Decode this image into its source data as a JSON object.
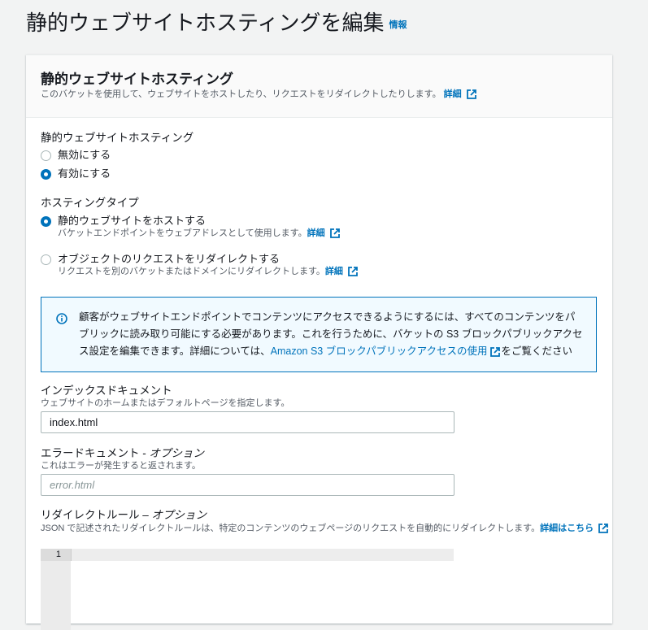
{
  "page": {
    "title": "静的ウェブサイトホスティングを編集",
    "info_link": "情報"
  },
  "card": {
    "title": "静的ウェブサイトホスティング",
    "description": "このバケットを使用して、ウェブサイトをホストしたり、リクエストをリダイレクトしたりします。",
    "details_link": "詳細"
  },
  "hosting": {
    "label": "静的ウェブサイトホスティング",
    "options": [
      {
        "label": "無効にする",
        "selected": false
      },
      {
        "label": "有効にする",
        "selected": true
      }
    ]
  },
  "hosting_type": {
    "label": "ホスティングタイプ",
    "options": [
      {
        "label": "静的ウェブサイトをホストする",
        "description": "バケットエンドポイントをウェブアドレスとして使用します。",
        "link": "詳細",
        "selected": true
      },
      {
        "label": "オブジェクトのリクエストをリダイレクトする",
        "description": "リクエストを別のバケットまたはドメインにリダイレクトします。",
        "link": "詳細",
        "selected": false
      }
    ]
  },
  "alert": {
    "text": "顧客がウェブサイトエンドポイントでコンテンツにアクセスできるようにするには、すべてのコンテンツをパブリックに読み取り可能にする必要があります。これを行うために、バケットの S3 ブロックパブリックアクセス設定を編集できます。詳細については、",
    "link": "Amazon S3 ブロックパブリックアクセスの使用",
    "suffix": "をご覧ください"
  },
  "index_doc": {
    "label": "インデックスドキュメント",
    "description": "ウェブサイトのホームまたはデフォルトページを指定します。",
    "value": "index.html"
  },
  "error_doc": {
    "label": "エラードキュメント - ",
    "label_optional": "オプション",
    "description": "これはエラーが発生すると返されます。",
    "placeholder": "error.html"
  },
  "redirect": {
    "label": "リダイレクトルール – ",
    "label_optional": "オプション",
    "description": "JSON で記述されたリダイレクトルールは、特定のコンテンツのウェブページのリクエストを自動的にリダイレクトします。",
    "link": "詳細はこちら",
    "line_number": "1"
  }
}
